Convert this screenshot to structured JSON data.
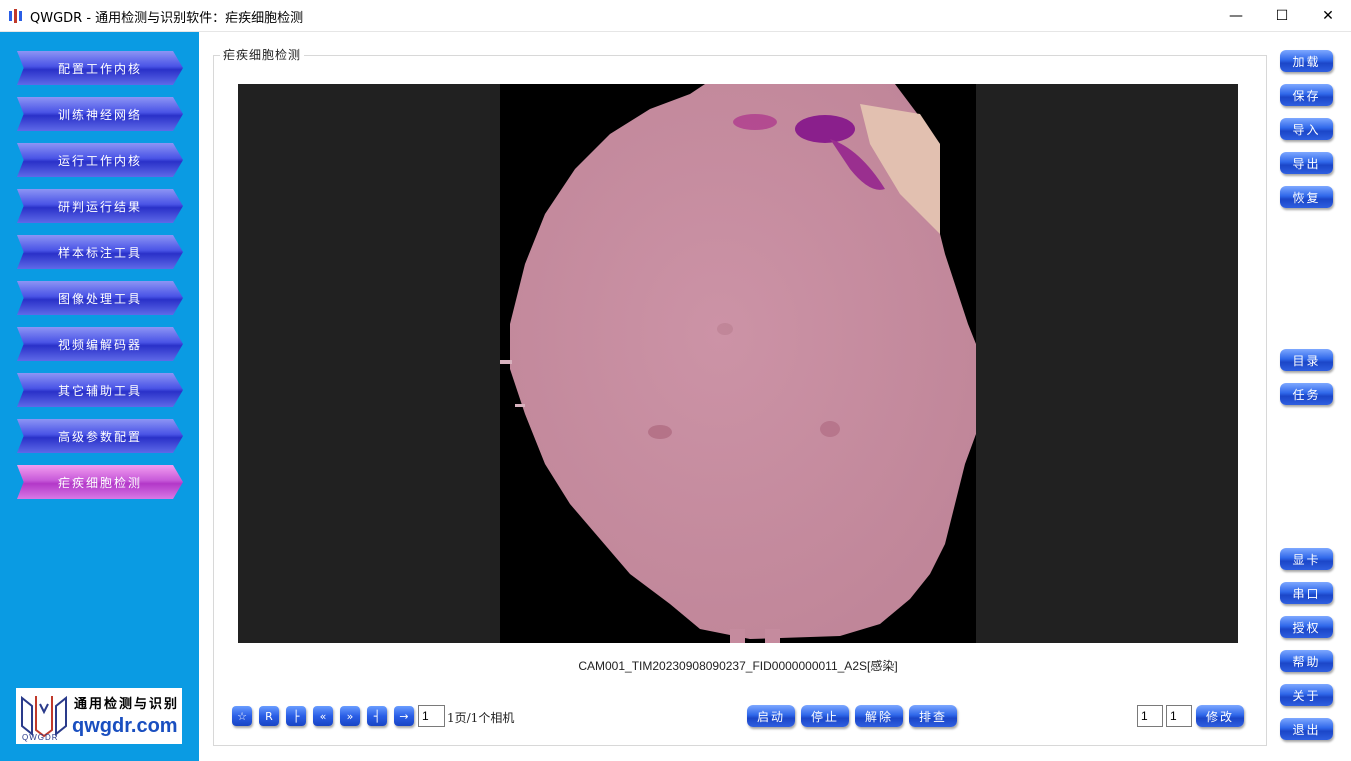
{
  "window": {
    "title": "QWGDR - 通用检测与识别软件：疟疾细胞检测",
    "minimize_glyph": "—",
    "maximize_glyph": "☐",
    "close_glyph": "✕"
  },
  "sidebar": {
    "items": [
      {
        "label": "配置工作内核"
      },
      {
        "label": "训练神经网络"
      },
      {
        "label": "运行工作内核"
      },
      {
        "label": "研判运行结果"
      },
      {
        "label": "样本标注工具"
      },
      {
        "label": "图像处理工具"
      },
      {
        "label": "视频编解码器"
      },
      {
        "label": "其它辅助工具"
      },
      {
        "label": "高级参数配置"
      },
      {
        "label": "疟疾细胞检测"
      }
    ],
    "active_index": 9,
    "logo": {
      "title": "通用检测与识别",
      "url": "qwgdr.com",
      "sub": "QWGDR"
    }
  },
  "panel": {
    "title": "疟疾细胞检测",
    "filename": "CAM001_TIM20230908090237_FID0000000011_A2S[感染]"
  },
  "bottom_toolbar": {
    "nav_buttons": [
      {
        "name": "star-icon",
        "glyph": "☆"
      },
      {
        "name": "r-icon",
        "glyph": "R"
      },
      {
        "name": "first-icon",
        "glyph": "├"
      },
      {
        "name": "prev-page-icon",
        "glyph": "«"
      },
      {
        "name": "next-page-icon",
        "glyph": "»"
      },
      {
        "name": "last-icon",
        "glyph": "┤"
      },
      {
        "name": "goto-icon",
        "glyph": "→"
      }
    ],
    "page_input": "1",
    "page_label": "1页/1个相机",
    "actions": [
      "启动",
      "停止",
      "解除",
      "排查"
    ],
    "field_a": "1",
    "field_b": "1",
    "modify": "修改"
  },
  "right_buttons": {
    "top": [
      "加载",
      "保存",
      "导入",
      "导出",
      "恢复"
    ],
    "middle": [
      "目录",
      "任务"
    ],
    "bottom": [
      "显卡",
      "串口",
      "授权",
      "帮助",
      "关于",
      "退出"
    ]
  },
  "colors": {
    "sidebar_bg": "#0a9be3",
    "nav_blue": "#3b45d9",
    "nav_active": "#c24fd6",
    "button_blue": "#2a5ee6",
    "cell_pink": "#c98fa3",
    "parasite_purple": "#8a1f8c"
  }
}
